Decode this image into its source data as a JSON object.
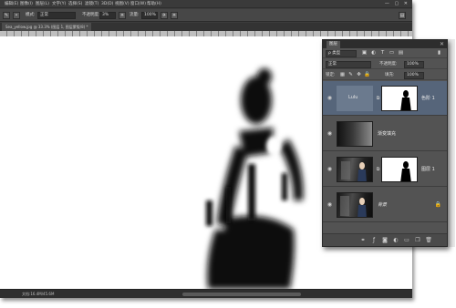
{
  "menubar": {
    "items": [
      "编辑(E)",
      "图像(I)",
      "图层(L)",
      "文字(Y)",
      "选择(S)",
      "滤镜(T)",
      "3D(D)",
      "视图(V)",
      "窗口(W)",
      "帮助(H)"
    ],
    "window_controls": "— ▢ ✕"
  },
  "options": {
    "mode_label": "模式:",
    "mode_value": "正常",
    "opacity_label": "不透明度:",
    "opacity_value": "3%",
    "flow_label": "流量:",
    "flow_value": "100%"
  },
  "document": {
    "tab_label": "Sea_yellow.jpg @ 33.3% (图层 1, 图层蒙版/8) *",
    "status_text": "文档:16.4M/45.6M"
  },
  "layers_panel": {
    "tab_label": "图层",
    "close_glyph": "✕",
    "filter_label": "ρ 类型",
    "blend_mode": "正常",
    "opacity_label": "不透明度:",
    "opacity_value": "100%",
    "lock_label": "锁定:",
    "fill_label": "填充:",
    "fill_value": "100%",
    "layers": [
      {
        "name": "色阶 1",
        "thumb_text": "Lulu",
        "selected": true
      },
      {
        "name": "渐变填充",
        "selected": false
      },
      {
        "name": "图层 1",
        "selected": false
      },
      {
        "name": "背景",
        "selected": false
      }
    ],
    "lock_glyph": "🔒"
  },
  "colors": {
    "selected_layer": "#56657a",
    "panel_bg": "#535353",
    "app_bg": "#3c3c3c"
  }
}
